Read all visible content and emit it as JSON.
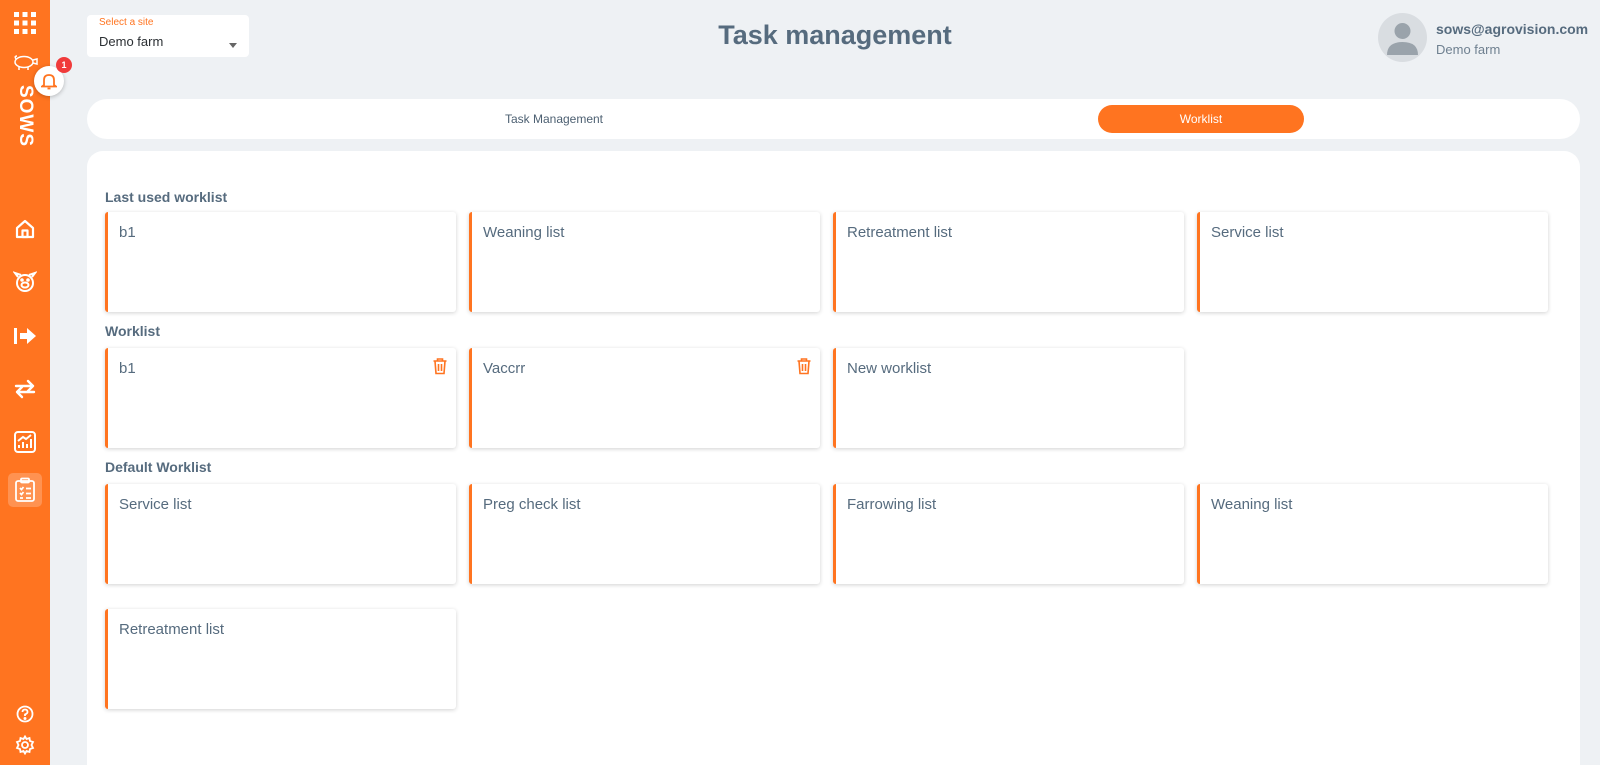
{
  "sidebar": {
    "brand": "SOWS",
    "notification_count": "1",
    "nav_icons": [
      "apps-grid-icon",
      "pig-icon",
      "home-icon",
      "sow-face-icon",
      "exit-arrow-icon",
      "transfer-arrows-icon",
      "reports-chart-icon",
      "clipboard-icon"
    ],
    "bottom_icons": [
      "help-icon",
      "settings-icon"
    ],
    "accent_color": "#ff7420"
  },
  "header": {
    "site_label": "Select a site",
    "site_value": "Demo farm",
    "title": "Task management",
    "user_email": "sows@agrovision.com",
    "user_farm": "Demo farm"
  },
  "tabs": [
    {
      "label": "Task Management",
      "active": false
    },
    {
      "label": "Worklist",
      "active": true
    }
  ],
  "sections": {
    "last_used": {
      "title": "Last used worklist",
      "items": [
        "b1",
        "Weaning list",
        "Retreatment list",
        "Service list"
      ]
    },
    "worklist": {
      "title": "Worklist",
      "items": [
        {
          "label": "b1",
          "deletable": true
        },
        {
          "label": "Vaccrr",
          "deletable": true
        },
        {
          "label": "New worklist",
          "deletable": false
        }
      ]
    },
    "default": {
      "title": "Default Worklist",
      "items": [
        "Service list",
        "Preg check list",
        "Farrowing list",
        "Weaning list",
        "Retreatment list"
      ]
    }
  }
}
